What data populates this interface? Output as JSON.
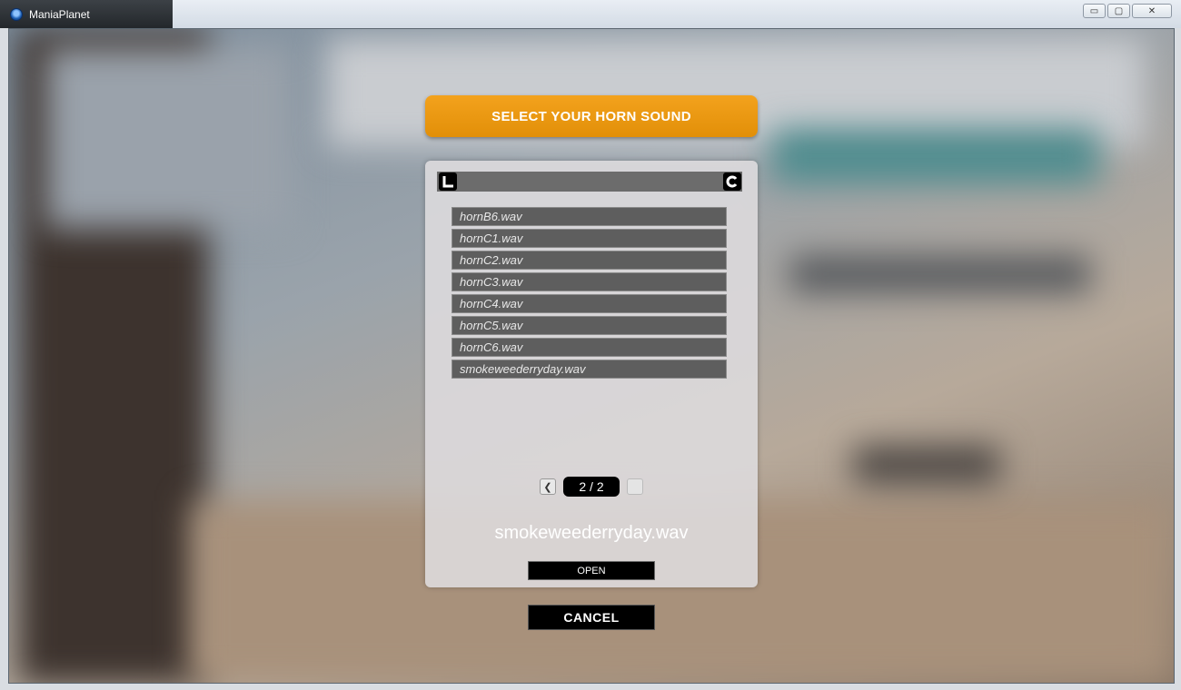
{
  "window": {
    "title": "ManiaPlanet",
    "minimize_glyph": "▭",
    "maximize_glyph": "▢",
    "close_glyph": "✕"
  },
  "dialog": {
    "title": "SELECT YOUR HORN SOUND",
    "parent_folder_icon": "folder-up-icon",
    "refresh_icon": "refresh-icon",
    "files": [
      "hornB6.wav",
      "hornC1.wav",
      "hornC2.wav",
      "hornC3.wav",
      "hornC4.wav",
      "hornC5.wav",
      "hornC6.wav",
      "smokeweederryday.wav"
    ],
    "pager": {
      "label": "2 / 2",
      "prev_glyph": "❮"
    },
    "selected_file": "smokeweederryday.wav",
    "open_label": "OPEN",
    "cancel_label": "CANCEL"
  },
  "colors": {
    "accent": "#e8950f",
    "file_item_bg": "#5e5e5e",
    "panel_bg": "#dedcde"
  }
}
